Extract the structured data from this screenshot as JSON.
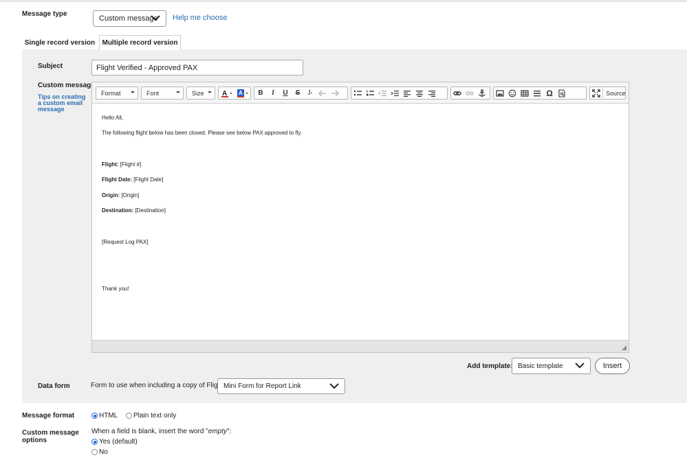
{
  "message_type": {
    "label": "Message type",
    "value": "Custom message",
    "help_link": "Help me choose"
  },
  "tabs": [
    {
      "label": "Single record version",
      "active": true
    },
    {
      "label": "Multiple record version",
      "active": false
    }
  ],
  "subject": {
    "label": "Subject",
    "value": "Flight Verified - Approved PAX"
  },
  "custom_message": {
    "label": "Custom message",
    "tips_link": "Tips on creating a custom email message"
  },
  "toolbar": {
    "format": "Format",
    "font": "Font",
    "size": "Size",
    "source": "Source",
    "icons": [
      "text-color-icon",
      "background-color-icon",
      "bold-icon",
      "italic-icon",
      "underline-icon",
      "strikethrough-icon",
      "remove-format-icon",
      "undo-icon",
      "redo-icon",
      "bulleted-list-icon",
      "numbered-list-icon",
      "decrease-indent-icon",
      "increase-indent-icon",
      "align-left-icon",
      "align-center-icon",
      "align-right-icon",
      "link-icon",
      "unlink-icon",
      "anchor-icon",
      "image-icon",
      "smiley-icon",
      "table-icon",
      "horizontal-line-icon",
      "special-char-icon",
      "preview-icon",
      "maximize-icon",
      "source-icon"
    ]
  },
  "editor_body": {
    "greeting": "Hello All,",
    "intro": "The following flight below has been closed.  Please see below PAX approved to fly.",
    "fields": [
      {
        "label": "Flight:",
        "value": " [Flight #]"
      },
      {
        "label": "Flight Date:",
        "value": " [Flight Date]"
      },
      {
        "label": "Origin:",
        "value": " [Origin]"
      },
      {
        "label": "Destination:",
        "value": " [Destination]"
      }
    ],
    "request_log": "[Request Log PAX]",
    "closing": "Thank you!"
  },
  "add_template": {
    "label": "Add template:",
    "value": "Basic template",
    "button": "Insert"
  },
  "data_form": {
    "label": "Data form",
    "prompt": "Form to use when including a copy of Flight:",
    "value": "Mini Form for Report Link"
  },
  "message_format": {
    "label": "Message format",
    "options": [
      {
        "label": "HTML",
        "selected": true
      },
      {
        "label": "Plain text only",
        "selected": false
      }
    ]
  },
  "custom_options": {
    "label": "Custom message options",
    "question_prefix": "When a field is blank, insert the word \"",
    "question_word": "empty",
    "question_suffix": "\":",
    "options": [
      {
        "label": "Yes  (default)",
        "selected": true
      },
      {
        "label": "No",
        "selected": false
      }
    ]
  },
  "colors": {
    "accent": "#1a66c8",
    "link": "#2a6fb3",
    "panel": "#efefef"
  }
}
